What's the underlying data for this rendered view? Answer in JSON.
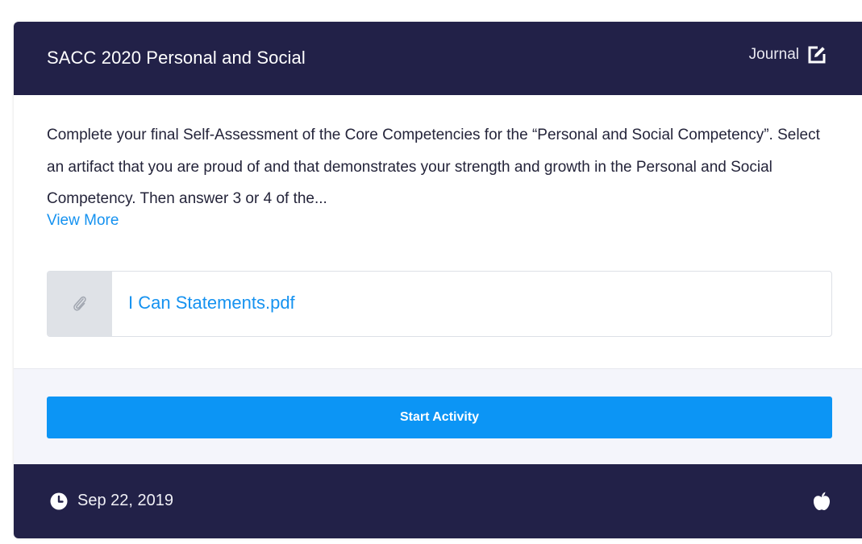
{
  "card": {
    "title": "SACC 2020 Personal and Social",
    "type_label": "Journal",
    "type_icon": "edit-icon",
    "description": "Complete your final Self-Assessment of the Core Competencies for the “Personal and Social Competency”.  Select an artifact that you are proud of and that demonstrates your strength and growth in the Personal and Social Competency. Then answer 3 or 4 of the...",
    "view_more_label": "View More",
    "attachment": {
      "icon": "paperclip-icon",
      "name": "I Can Statements.pdf"
    },
    "start_button_label": "Start Activity",
    "footer": {
      "clock_icon": "clock-icon",
      "date": "Sep 22, 2019",
      "status_icon": "apple-icon"
    }
  },
  "colors": {
    "header_bg": "#222148",
    "accent_blue": "#1592f0",
    "button_blue": "#0c95f5",
    "action_bg": "#f4f5fb"
  }
}
